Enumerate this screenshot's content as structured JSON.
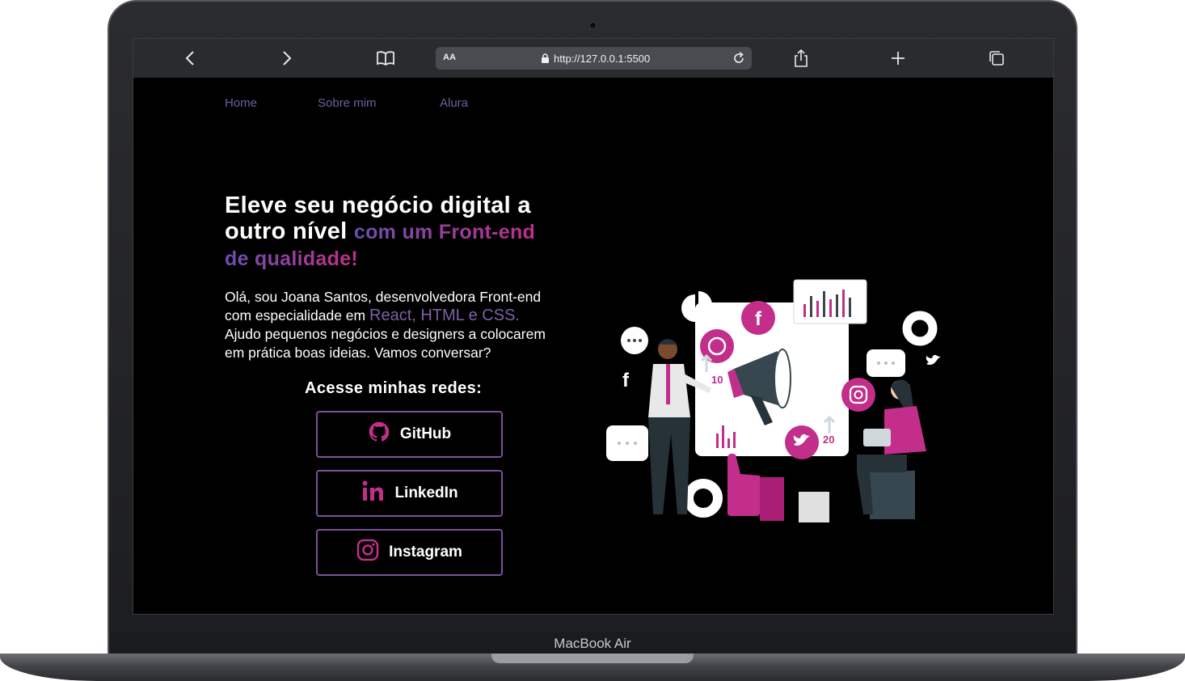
{
  "device": {
    "label": "MacBook Air"
  },
  "browser": {
    "reader_label": "AA",
    "url": "http://127.0.0.1:5500",
    "icons": [
      "back-icon",
      "forward-icon",
      "bookmarks-icon",
      "lock-icon",
      "reload-icon",
      "share-icon",
      "new-tab-icon",
      "tabs-icon"
    ]
  },
  "nav": {
    "items": [
      {
        "label": "Home"
      },
      {
        "label": "Sobre mim"
      },
      {
        "label": "Alura"
      }
    ]
  },
  "hero": {
    "headline_line1": "Eleve seu negócio digital a",
    "headline_line2_start": "outro nível",
    "headline_accent_1": "com um Front-end",
    "headline_accent_2": "de qualidade!",
    "intro_1": "Olá, sou Joana Santos, desenvolvedora Front-end",
    "intro_2": "com especialidade em",
    "intro_highlight": "React, HTML e CSS.",
    "intro_3": "Ajudo pequenos negócios e designers a colocarem",
    "intro_4": "em prática boas ideias. Vamos conversar?"
  },
  "social": {
    "title": "Acesse minhas redes:",
    "links": [
      {
        "label": "GitHub",
        "icon": "github-icon"
      },
      {
        "label": "LinkedIn",
        "icon": "linkedin-icon"
      },
      {
        "label": "Instagram",
        "icon": "instagram-icon"
      }
    ]
  },
  "illustration": {
    "badge_1": "10",
    "badge_2": "20",
    "icons": [
      "megaphone-icon",
      "whatsapp-icon",
      "facebook-icon",
      "instagram-icon",
      "twitter-icon",
      "thumbs-up-icon",
      "chat-bubble-icon",
      "pie-chart-icon",
      "bar-chart-icon"
    ]
  },
  "colors": {
    "accent_pink": "#c22e8a",
    "accent_purple": "#6a4fb0",
    "nav_text": "#6f5f9e",
    "background": "#000000"
  }
}
